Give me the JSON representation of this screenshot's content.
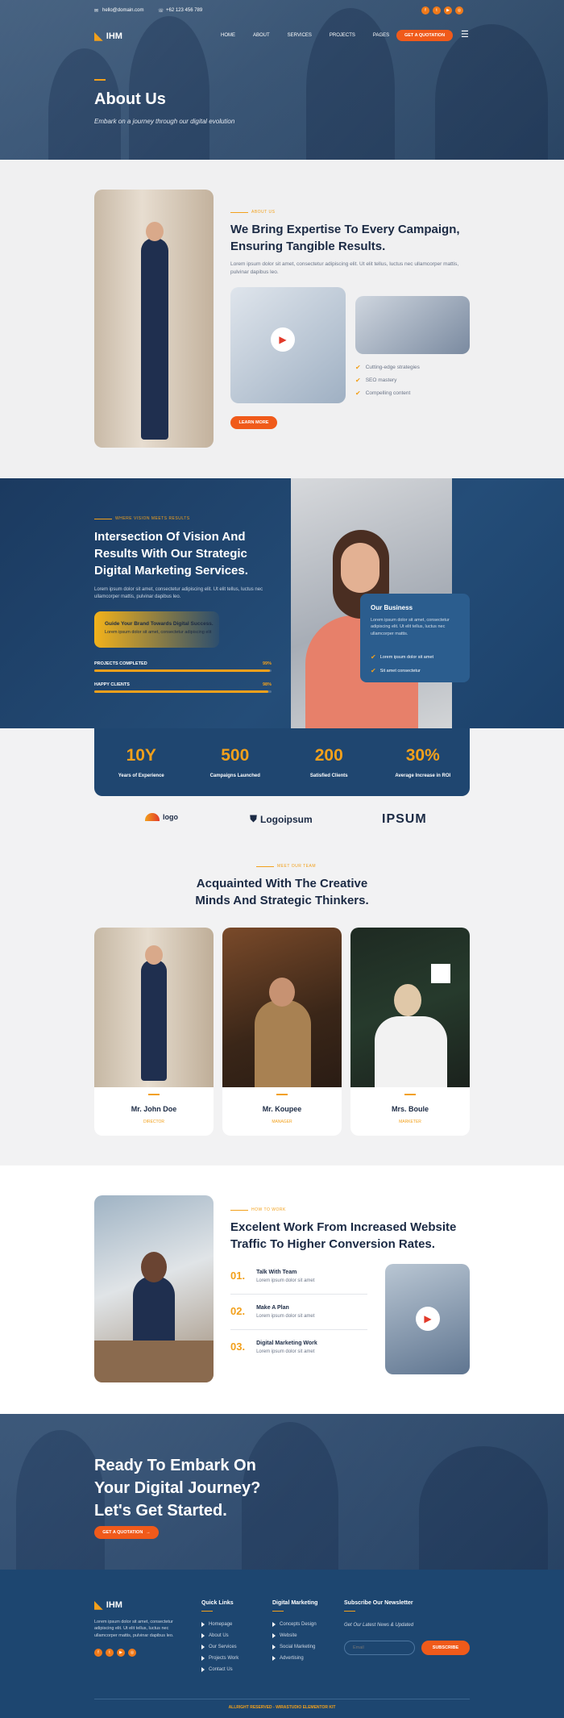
{
  "topbar": {
    "email": "hello@domain.com",
    "phone": "+62 123 456 789"
  },
  "brand": {
    "logo_text": "IHM"
  },
  "nav": {
    "items": [
      "HOME",
      "ABOUT",
      "SERVICES",
      "PROJECTS",
      "PAGES"
    ],
    "active": "ABOUT",
    "quote_button": "GET A QUOTATION"
  },
  "hero": {
    "title": "About Us",
    "subtitle": "Embark on a journey through our digital evolution"
  },
  "about": {
    "kicker": "ABOUT US",
    "heading": "We Bring Expertise To Every Campaign, Ensuring Tangible Results.",
    "body": "Lorem ipsum dolor sit amet, consectetur adipiscing elit. Ut elit tellus, luctus nec ullamcorper mattis, pulvinar dapibus leo.",
    "checklist": [
      "Cutting-edge strategies",
      "SEO mastery",
      "Compelling content"
    ],
    "button": "LEARN MORE"
  },
  "vision": {
    "kicker": "WHERE VISION MEETS RESULTS",
    "heading": "Intersection Of Vision And Results With Our Strategic Digital Marketing Services.",
    "body": "Lorem ipsum dolor sit amet, consectetur adipiscing elit. Ut elit tellus, luctus nec ullamcorper mattis, pulvinar dapibus leo.",
    "callout_title": "Guide Your Brand Towards Digital Success.",
    "callout_body": "Lorem ipsum dolor sit amet, consectetur adipiscing elit",
    "progress": [
      {
        "label": "PROJECTS COMPLETED",
        "value": "99%",
        "fraction": 0.99
      },
      {
        "label": "HAPPY CLIENTS",
        "value": "98%",
        "fraction": 0.98
      }
    ],
    "card": {
      "title": "Our Business",
      "body": "Lorem ipsum dolor sit amet, consectetur adipiscing elit. Ut elit tellus, luctus nec ullamcorper mattis.",
      "items": [
        "Lorem ipsum dolor sit amet",
        "Sit amet consectetur"
      ]
    }
  },
  "stats": [
    {
      "value": "10Y",
      "label": "Years of Experience"
    },
    {
      "value": "500",
      "label": "Campaigns Launched"
    },
    {
      "value": "200",
      "label": "Satisfied Clients"
    },
    {
      "value": "30%",
      "label": "Average Increase in ROI"
    }
  ],
  "logos": [
    "logo",
    "Logoipsum",
    "IPSUM"
  ],
  "team": {
    "kicker": "MEET OUR TEAM",
    "heading": "Acquainted With The Creative Minds And Strategic Thinkers.",
    "members": [
      {
        "name": "Mr. John Doe",
        "role": "DIRECTOR"
      },
      {
        "name": "Mr. Koupee",
        "role": "MANAGER"
      },
      {
        "name": "Mrs. Boule",
        "role": "MARKETER"
      }
    ]
  },
  "work": {
    "kicker": "HOW TO WORK",
    "heading": "Excelent Work From Increased Website Traffic To Higher Conversion Rates.",
    "steps": [
      {
        "num": "01.",
        "title": "Talk With Team",
        "desc": "Lorem ipsum dolor sit amet"
      },
      {
        "num": "02.",
        "title": "Make A Plan",
        "desc": "Lorem ipsum dolor sit amet"
      },
      {
        "num": "03.",
        "title": "Digital Marketing Work",
        "desc": "Lorem ipsum dolor sit amet"
      }
    ]
  },
  "cta": {
    "line1": "Ready To Embark On",
    "line2": "Your Digital Journey?",
    "line3": "Let's Get Started.",
    "button": "GET A QUOTATION"
  },
  "footer": {
    "about": "Lorem ipsum dolor sit amet, consectetur adipiscing elit. Ut elit tellus, luctus nec ullamcorper mattis, pulvinar dapibus leo.",
    "quick_links_title": "Quick Links",
    "quick_links": [
      "Homepage",
      "About Us",
      "Our Services",
      "Projects Work",
      "Contact Us"
    ],
    "digital_title": "Digital Marketing",
    "digital_links": [
      "Concepts Design",
      "Website",
      "Social Marketing",
      "Advertising"
    ],
    "newsletter_title": "Subscribe Our Newsletter",
    "newsletter_sub": "Get Our Latest News & Updated",
    "email_placeholder": "Email",
    "subscribe": "SUBSCRIBE",
    "copyright": "ALLRIGHT RESERVED - WIRASTUDIO ELEMENTOR KIT"
  },
  "colors": {
    "accent": "#f2a01b",
    "button": "#f05a1a",
    "navy": "#1d4670"
  }
}
